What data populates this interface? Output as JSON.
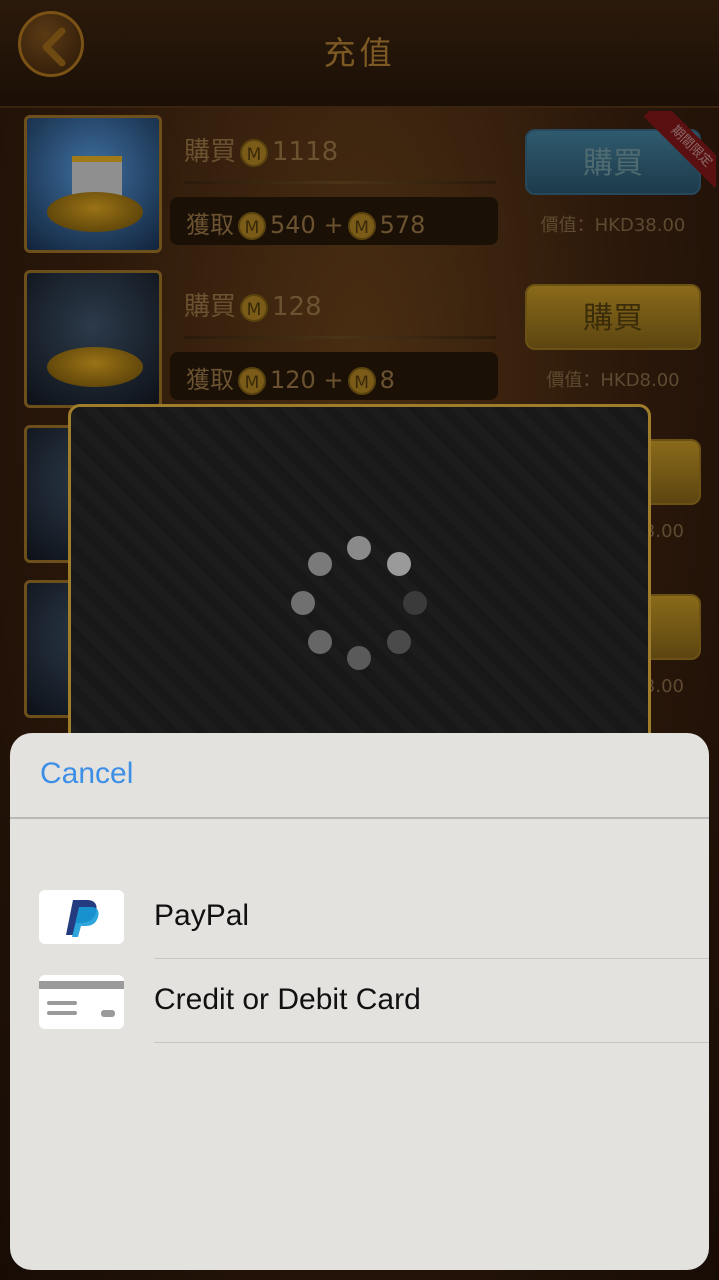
{
  "header": {
    "title": "充值"
  },
  "products": [
    {
      "buy_label": "購買",
      "buy_amount": "1118",
      "get_label": "獲取",
      "get_base": "540",
      "get_bonus": "578",
      "button_label": "購買",
      "price": "價值：HKD38.00",
      "ribbon": "期間限定"
    },
    {
      "buy_label": "購買",
      "buy_amount": "128",
      "get_label": "獲取",
      "get_base": "120",
      "get_bonus": "8",
      "button_label": "購買",
      "price": "價值：HKD8.00"
    },
    {
      "price_partial": "3.00"
    },
    {
      "price_partial": "3.00"
    }
  ],
  "coin_symbol": "M",
  "plus_sign": "+",
  "action_sheet": {
    "cancel_label": "Cancel",
    "options": [
      {
        "label": "PayPal",
        "icon": "paypal-icon"
      },
      {
        "label": "Credit or Debit Card",
        "icon": "card-icon"
      }
    ]
  },
  "colors": {
    "accent_blue": "#3d8fe6",
    "gold_border": "#a07d2a",
    "sheet_bg": "#e4e2df"
  }
}
